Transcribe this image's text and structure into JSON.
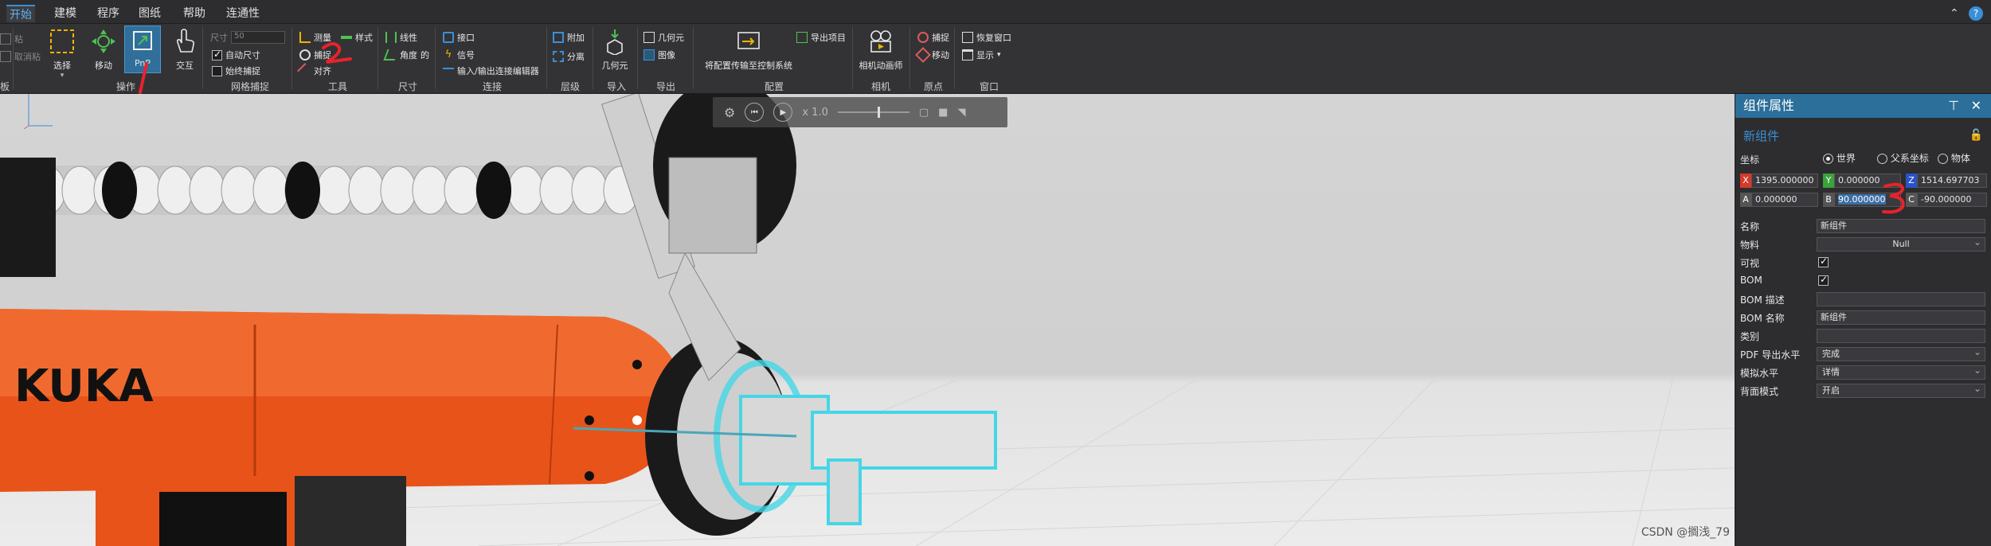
{
  "menu": {
    "tabs": [
      "开始",
      "建模",
      "程序",
      "图纸",
      "帮助",
      "连通性"
    ],
    "help": "?"
  },
  "ribbon": {
    "left_cut": {
      "item1": "粘",
      "item2": "取消粘",
      "group": "板"
    },
    "operate": {
      "select": "选择",
      "move": "移动",
      "pnp": "PnP",
      "interact": "交互",
      "group": "操作"
    },
    "grid_snap": {
      "size_label": "尺寸",
      "size_value": "50",
      "auto_size": "自动尺寸",
      "always_snap": "始终捕捉",
      "group": "网格捕捉"
    },
    "tools": {
      "measure": "测量",
      "style": "样式",
      "snap": "捕捉",
      "align": "对齐",
      "group": "工具"
    },
    "dimension": {
      "linear": "线性",
      "angle": "角度",
      "radius": "的",
      "group": "尺寸"
    },
    "connect": {
      "interface": "接口",
      "signal": "信号",
      "io": "输入/输出连接编辑器",
      "group": "连接"
    },
    "hierarchy": {
      "attach": "附加",
      "detach": "分离",
      "group": "层级"
    },
    "import": {
      "geometry": "几何元",
      "group": "导入"
    },
    "export": {
      "geometry": "几何元",
      "image": "图像",
      "group": "导出"
    },
    "config": {
      "upload": "将配置传输至控制系统",
      "export_item": "导出项目",
      "group": "配置"
    },
    "camera": {
      "animator": "相机动画师",
      "group": "相机"
    },
    "origin": {
      "snap": "捕捉",
      "move": "移动",
      "group": "原点"
    },
    "window": {
      "restore": "恢复窗口",
      "show": "显示",
      "group": "窗口"
    }
  },
  "playback": {
    "speed": "x 1.0"
  },
  "viewport": {
    "robot_brand": "KUKA",
    "watermark": "CSDN @搁浅_79"
  },
  "props": {
    "title": "组件属性",
    "component_name": "新组件",
    "coord_label": "坐标",
    "coord_options": [
      "世界",
      "父系坐标",
      "物体"
    ],
    "coord_selected": "世界",
    "pos": {
      "x": "1395.000000",
      "y": "0.000000",
      "z": "1514.697703"
    },
    "rot": {
      "a": "0.000000",
      "b": "90.000000",
      "c": "-90.000000"
    },
    "fields": [
      {
        "label": "名称",
        "value": "新组件",
        "kind": "text"
      },
      {
        "label": "物料",
        "value": "Null",
        "kind": "select"
      },
      {
        "label": "可视",
        "value": "",
        "kind": "check"
      },
      {
        "label": "BOM",
        "value": "",
        "kind": "check"
      },
      {
        "label": "BOM 描述",
        "value": "",
        "kind": "text"
      },
      {
        "label": "BOM 名称",
        "value": "新组件",
        "kind": "text"
      },
      {
        "label": "类别",
        "value": "",
        "kind": "text"
      },
      {
        "label": "PDF 导出水平",
        "value": "完成",
        "kind": "select"
      },
      {
        "label": "模拟水平",
        "value": "详情",
        "kind": "select"
      },
      {
        "label": "背面模式",
        "value": "开启",
        "kind": "select"
      }
    ]
  },
  "colors": {
    "accent": "#3b8fd6",
    "panel_header": "#2b6f9a",
    "robot_orange": "#e8531a",
    "annotation_red": "#e8232a",
    "gripper_glow": "#45d6e6"
  }
}
